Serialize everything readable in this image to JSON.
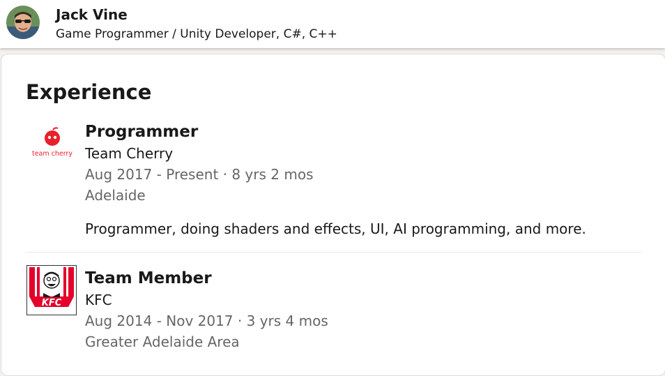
{
  "profile": {
    "name": "Jack Vine",
    "headline": "Game Programmer / Unity Developer, C#, C++"
  },
  "experience": {
    "title": "Experience",
    "items": [
      {
        "title": "Programmer",
        "company": "Team Cherry",
        "dates": "Aug 2017 - Present · 8 yrs 2 mos",
        "location": "Adelaide",
        "description": "Programmer, doing shaders and effects, UI, AI programming, and more.",
        "logo_text": "team cherry"
      },
      {
        "title": "Team Member",
        "company": "KFC",
        "dates": "Aug 2014 - Nov 2017 · 3 yrs 4 mos",
        "location": "Greater Adelaide Area",
        "logo_text": "KFC"
      }
    ]
  },
  "colors": {
    "cherry_red": "#e8202a",
    "kfc_red": "#e4002b",
    "muted_text": "#666666"
  }
}
